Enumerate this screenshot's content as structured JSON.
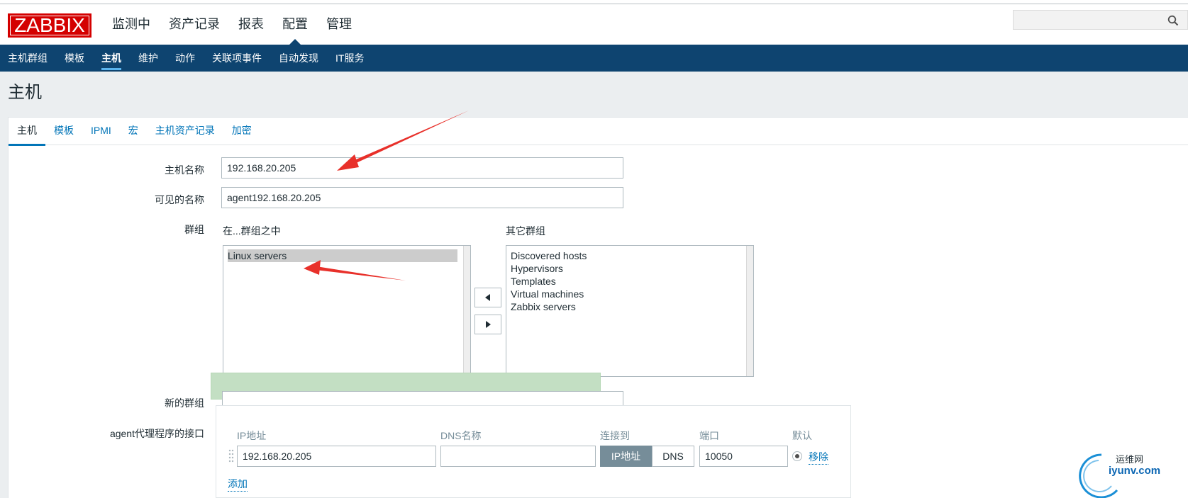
{
  "logo": "ZABBIX",
  "main_menu": [
    "监测中",
    "资产记录",
    "报表",
    "配置",
    "管理"
  ],
  "main_menu_selected": "配置",
  "sub_menu": [
    "主机群组",
    "模板",
    "主机",
    "维护",
    "动作",
    "关联项事件",
    "自动发现",
    "IT服务"
  ],
  "sub_menu_selected": "主机",
  "page_title": "主机",
  "tabs": [
    "主机",
    "模板",
    "IPMI",
    "宏",
    "主机资产记录",
    "加密"
  ],
  "tabs_selected": "主机",
  "form": {
    "host_name_label": "主机名称",
    "host_name_value": "192.168.20.205",
    "visible_name_label": "可见的名称",
    "visible_name_value": "agent192.168.20.205",
    "groups_label": "群组",
    "in_groups_label": "在...群组之中",
    "other_groups_label": "其它群组",
    "in_groups": [
      "Linux servers"
    ],
    "other_groups": [
      "Discovered hosts",
      "Hypervisors",
      "Templates",
      "Virtual machines",
      "Zabbix servers"
    ],
    "new_group_label": "新的群组",
    "new_group_value": "",
    "agent_interfaces_label": "agent代理程序的接口",
    "iface_headers": {
      "ip": "IP地址",
      "dns": "DNS名称",
      "connect": "连接到",
      "port": "端口",
      "default": "默认"
    },
    "iface_row": {
      "ip": "192.168.20.205",
      "dns": "",
      "connect_ip": "IP地址",
      "connect_dns": "DNS",
      "port": "10050",
      "remove": "移除"
    },
    "add_link": "添加"
  },
  "watermark": {
    "line1": "运维网",
    "line2": "iyunv.com"
  },
  "colors": {
    "brand_red": "#d40000",
    "nav_blue": "#0e4470",
    "link_blue": "#0275b8",
    "annotation_red": "#e8302a"
  }
}
